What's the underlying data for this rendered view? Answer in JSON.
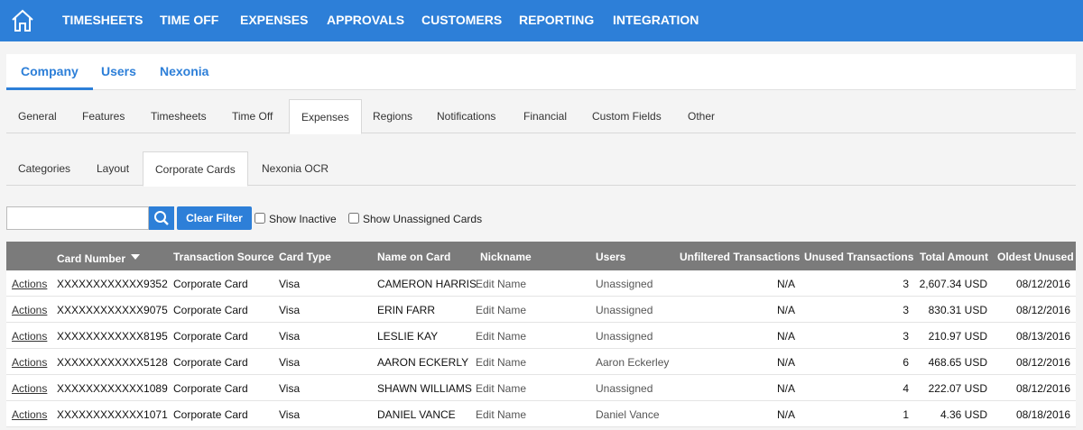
{
  "topnav": {
    "items": [
      "TIMESHEETS",
      "TIME OFF",
      "EXPENSES",
      "APPROVALS",
      "CUSTOMERS",
      "REPORTING",
      "INTEGRATION"
    ]
  },
  "tabs_l1": {
    "items": [
      "Company",
      "Users",
      "Nexonia"
    ],
    "active": "Company"
  },
  "tabs_l2": {
    "items": [
      "General",
      "Features",
      "Timesheets",
      "Time Off",
      "Expenses",
      "Regions",
      "Notifications",
      "Financial",
      "Custom Fields",
      "Other"
    ],
    "active": "Expenses"
  },
  "tabs_l3": {
    "items": [
      "Categories",
      "Layout",
      "Corporate Cards",
      "Nexonia OCR"
    ],
    "active": "Corporate Cards"
  },
  "filter": {
    "search_value": "",
    "clear_label": "Clear Filter",
    "show_inactive_label": "Show Inactive",
    "show_unassigned_label": "Show Unassigned Cards"
  },
  "table": {
    "headers": {
      "card_number": "Card Number",
      "transaction_source": "Transaction Source",
      "card_type": "Card Type",
      "name_on_card": "Name on Card",
      "nickname": "Nickname",
      "users": "Users",
      "unfiltered": "Unfiltered Transactions",
      "unused": "Unused Transactions",
      "total": "Total Amount",
      "oldest": "Oldest Unused"
    },
    "rows": [
      {
        "actions": "Actions",
        "card_number": "XXXXXXXXXXXX9352",
        "source": "Corporate Card",
        "type": "Visa",
        "name": "CAMERON HARRIS",
        "nickname": "Edit Name",
        "users": "Unassigned",
        "unfiltered": "N/A",
        "unused": "3",
        "total": "2,607.34 USD",
        "oldest": "08/12/2016"
      },
      {
        "actions": "Actions",
        "card_number": "XXXXXXXXXXXX9075",
        "source": "Corporate Card",
        "type": "Visa",
        "name": "ERIN FARR",
        "nickname": "Edit Name",
        "users": "Unassigned",
        "unfiltered": "N/A",
        "unused": "3",
        "total": "830.31 USD",
        "oldest": "08/12/2016"
      },
      {
        "actions": "Actions",
        "card_number": "XXXXXXXXXXXX8195",
        "source": "Corporate Card",
        "type": "Visa",
        "name": "LESLIE KAY",
        "nickname": "Edit Name",
        "users": "Unassigned",
        "unfiltered": "N/A",
        "unused": "3",
        "total": "210.97 USD",
        "oldest": "08/13/2016"
      },
      {
        "actions": "Actions",
        "card_number": "XXXXXXXXXXXX5128",
        "source": "Corporate Card",
        "type": "Visa",
        "name": "AARON ECKERLY",
        "nickname": "Edit Name",
        "users": "Aaron Eckerley",
        "unfiltered": "N/A",
        "unused": "6",
        "total": "468.65 USD",
        "oldest": "08/12/2016"
      },
      {
        "actions": "Actions",
        "card_number": "XXXXXXXXXXXX1089",
        "source": "Corporate Card",
        "type": "Visa",
        "name": "SHAWN WILLIAMS",
        "nickname": "Edit Name",
        "users": "Unassigned",
        "unfiltered": "N/A",
        "unused": "4",
        "total": "222.07 USD",
        "oldest": "08/12/2016"
      },
      {
        "actions": "Actions",
        "card_number": "XXXXXXXXXXXX1071",
        "source": "Corporate Card",
        "type": "Visa",
        "name": "DANIEL VANCE",
        "nickname": "Edit Name",
        "users": "Daniel Vance",
        "unfiltered": "N/A",
        "unused": "1",
        "total": "4.36 USD",
        "oldest": "08/18/2016"
      }
    ]
  },
  "colors": {
    "accent": "#2d7fd8",
    "header_bg": "#7b7b7b"
  }
}
